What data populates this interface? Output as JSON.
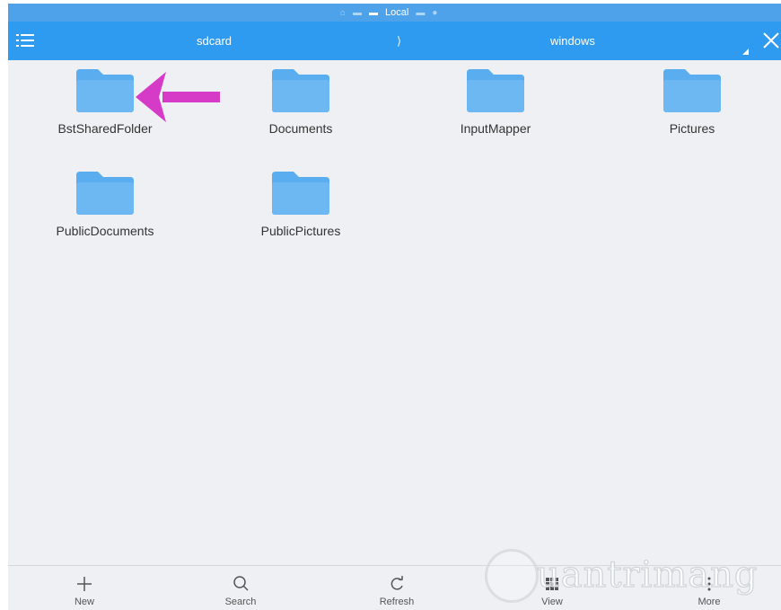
{
  "status": {
    "location_label": "Local"
  },
  "breadcrumb": {
    "items": [
      "sdcard",
      "windows"
    ],
    "separator": "⟩"
  },
  "folders": [
    {
      "name": "BstSharedFolder"
    },
    {
      "name": "Documents"
    },
    {
      "name": "InputMapper"
    },
    {
      "name": "Pictures"
    },
    {
      "name": "PublicDocuments"
    },
    {
      "name": "PublicPictures"
    }
  ],
  "toolbar": {
    "new_label": "New",
    "search_label": "Search",
    "refresh_label": "Refresh",
    "view_label": "View",
    "more_label": "More"
  },
  "watermark": {
    "text": "uantrimang"
  },
  "colors": {
    "appbar": "#2e9af0",
    "folder": "#5aaef0",
    "arrow": "#d63bc8",
    "background": "#eef0f3"
  }
}
